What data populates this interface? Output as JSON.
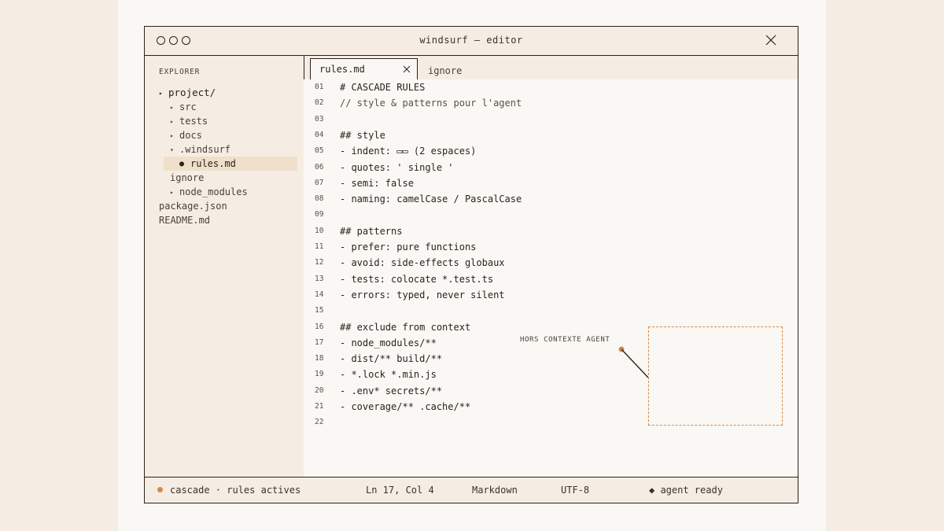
{
  "window": {
    "title": "windsurf — editor"
  },
  "explorer": {
    "label": "EXPLORER",
    "tree": [
      {
        "label": "project/",
        "arrow": "▸",
        "depth": 0,
        "kind": "folder"
      },
      {
        "label": "src",
        "arrow": "▸",
        "depth": 1,
        "kind": "folder"
      },
      {
        "label": "tests",
        "arrow": "▸",
        "depth": 1,
        "kind": "folder"
      },
      {
        "label": "docs",
        "arrow": "▸",
        "depth": 1,
        "kind": "folder"
      },
      {
        "label": ".windsurf",
        "arrow": "▾",
        "depth": 1,
        "kind": "folder-open"
      },
      {
        "label": "rules.md",
        "arrow": "●",
        "depth": 2,
        "kind": "file-selected"
      },
      {
        "label": "ignore",
        "arrow": "",
        "depth": 2,
        "kind": "file"
      },
      {
        "label": "node_modules",
        "arrow": "▸",
        "depth": 1,
        "kind": "folder"
      },
      {
        "label": "package.json",
        "arrow": "",
        "depth": 0,
        "kind": "file"
      },
      {
        "label": "README.md",
        "arrow": "",
        "depth": 0,
        "kind": "file"
      }
    ]
  },
  "tabs": [
    {
      "label": "rules.md",
      "active": true
    },
    {
      "label": "ignore",
      "active": false
    }
  ],
  "code_lines": [
    {
      "n": "01",
      "text": "# CASCADE RULES"
    },
    {
      "n": "02",
      "text": "// style & patterns pour l'agent",
      "comment": true
    },
    {
      "n": "03",
      "text": ""
    },
    {
      "n": "04",
      "text": "## style"
    },
    {
      "n": "05",
      "text": "- indent: ▭▭ (2 espaces)"
    },
    {
      "n": "06",
      "text": "- quotes: ' single '"
    },
    {
      "n": "07",
      "text": "- semi: false"
    },
    {
      "n": "08",
      "text": "- naming: camelCase / PascalCase"
    },
    {
      "n": "09",
      "text": ""
    },
    {
      "n": "10",
      "text": "## patterns"
    },
    {
      "n": "11",
      "text": "- prefer: pure functions"
    },
    {
      "n": "12",
      "text": "- avoid: side-effects globaux"
    },
    {
      "n": "13",
      "text": "- tests: colocate *.test.ts"
    },
    {
      "n": "14",
      "text": "- errors: typed, never silent"
    },
    {
      "n": "15",
      "text": ""
    },
    {
      "n": "16",
      "text": "## exclude from context"
    },
    {
      "n": "17",
      "text": "- node_modules/**"
    },
    {
      "n": "18",
      "text": "- dist/** build/**"
    },
    {
      "n": "19",
      "text": "- *.lock *.min.js"
    },
    {
      "n": "20",
      "text": "- .env* secrets/**"
    },
    {
      "n": "21",
      "text": "- coverage/** .cache/**"
    },
    {
      "n": "22",
      "text": ""
    }
  ],
  "annotation": {
    "label": "HORS CONTEXTE AGENT"
  },
  "status": {
    "cascade": "cascade · rules actives",
    "position": "Ln 17, Col 4",
    "language": "Markdown",
    "encoding": "UTF-8",
    "agent": "◆ agent ready"
  },
  "colors": {
    "accent": "#d48a4a",
    "ink": "#2a221c",
    "panel": "#f5ede3",
    "editor_bg": "#faf8f4",
    "selection": "#efdfcb"
  }
}
